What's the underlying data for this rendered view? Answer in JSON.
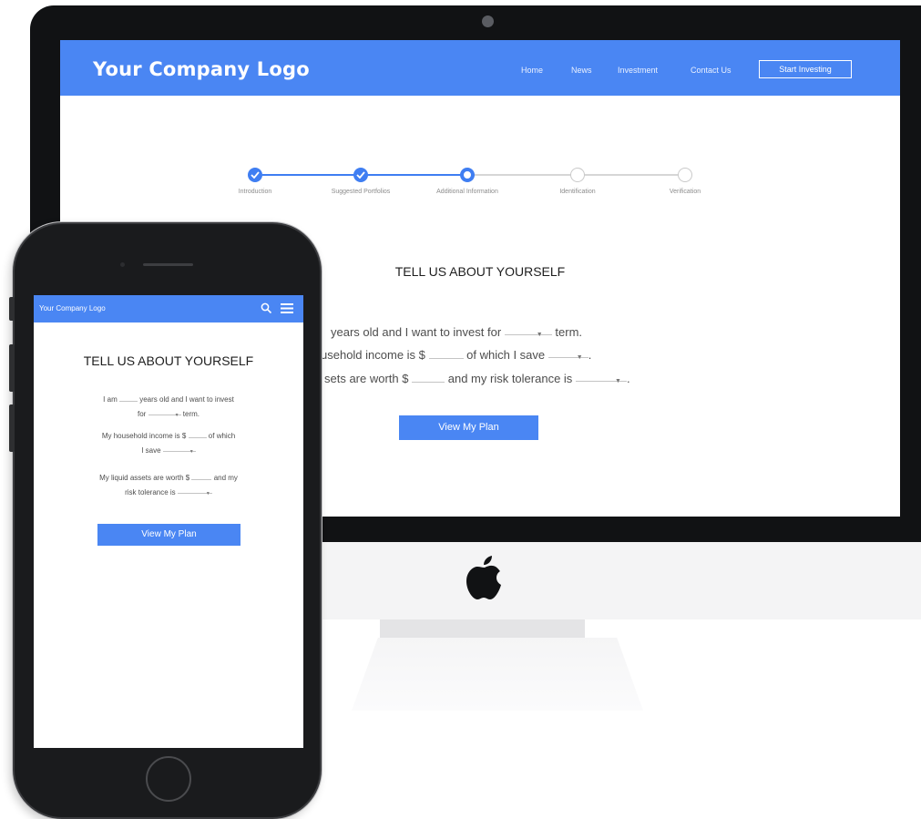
{
  "desktop": {
    "header": {
      "logo": "Your Company Logo",
      "nav": [
        "Home",
        "News",
        "Investment",
        "Contact Us"
      ],
      "cta": "Start Investing"
    },
    "steps": [
      {
        "label": "Introduction",
        "state": "done"
      },
      {
        "label": "Suggested Portfolios",
        "state": "done"
      },
      {
        "label": "Additional Information",
        "state": "current"
      },
      {
        "label": "Identification",
        "state": "todo"
      },
      {
        "label": "Verification",
        "state": "todo"
      }
    ],
    "form": {
      "title": "TELL US ABOUT YOURSELF",
      "line1": {
        "a": "years old and I want to invest for",
        "b": "term."
      },
      "line2": {
        "a": "usehold income is $",
        "b": "of which I save",
        "c": "."
      },
      "line3": {
        "a": "sets are worth $",
        "b": "and my risk tolerance is",
        "c": "."
      },
      "button": "View My Plan"
    }
  },
  "mobile": {
    "header": {
      "logo": "Your Company Logo"
    },
    "form": {
      "title": "TELL US ABOUT YOURSELF",
      "line1": {
        "a": "I am",
        "b": "years old and I want to invest",
        "c": "for",
        "d": "term."
      },
      "line2": {
        "a": "My household income is $",
        "b": "of which",
        "c": "I save"
      },
      "line3": {
        "a": "My liquid assets are worth $",
        "b": "and my",
        "c": "risk tolerance is"
      },
      "button": "View My Plan"
    }
  },
  "colors": {
    "brand_blue": "#4a86f3",
    "step_blue": "#3f7ef2"
  },
  "icons": [
    "check-icon",
    "search-icon",
    "menu-icon",
    "apple-logo-icon",
    "chevron-down-icon"
  ]
}
